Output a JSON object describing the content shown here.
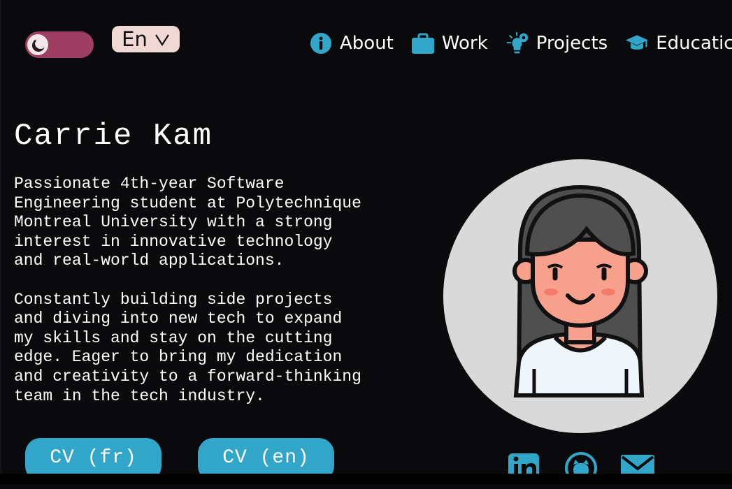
{
  "theme_toggle": {
    "icon": "moon-eye-icon"
  },
  "language": {
    "current": "En",
    "icon": "chevron-down-icon"
  },
  "nav": {
    "items": [
      {
        "label": "About",
        "icon": "info-icon"
      },
      {
        "label": "Work",
        "icon": "briefcase-icon"
      },
      {
        "label": "Projects",
        "icon": "lightbulb-gear-icon"
      },
      {
        "label": "Educatic",
        "icon": "graduation-cap-icon"
      }
    ]
  },
  "hero": {
    "name": "Carrie Kam",
    "bio": "Passionate 4th-year Software\nEngineering student at Polytechnique\nMontreal University with a strong\ninterest in innovative technology\nand real-world applications.\n\nConstantly building side projects\nand diving into new tech to expand\nmy skills and stay on the cutting\nedge. Eager to bring my dedication\nand creativity to a forward-thinking\nteam in the tech industry."
  },
  "cv": {
    "fr_label": "CV (fr)",
    "en_label": "CV (en)"
  },
  "social": {
    "linkedin_icon": "linkedin-icon",
    "github_icon": "github-icon",
    "mail_icon": "mail-icon"
  },
  "colors": {
    "background": "#0a0a0c",
    "accent": "#32a6c8",
    "toggle": "#9e3f62",
    "language_bg": "#f0d8d4",
    "avatar_bg": "#d9d9d9"
  }
}
